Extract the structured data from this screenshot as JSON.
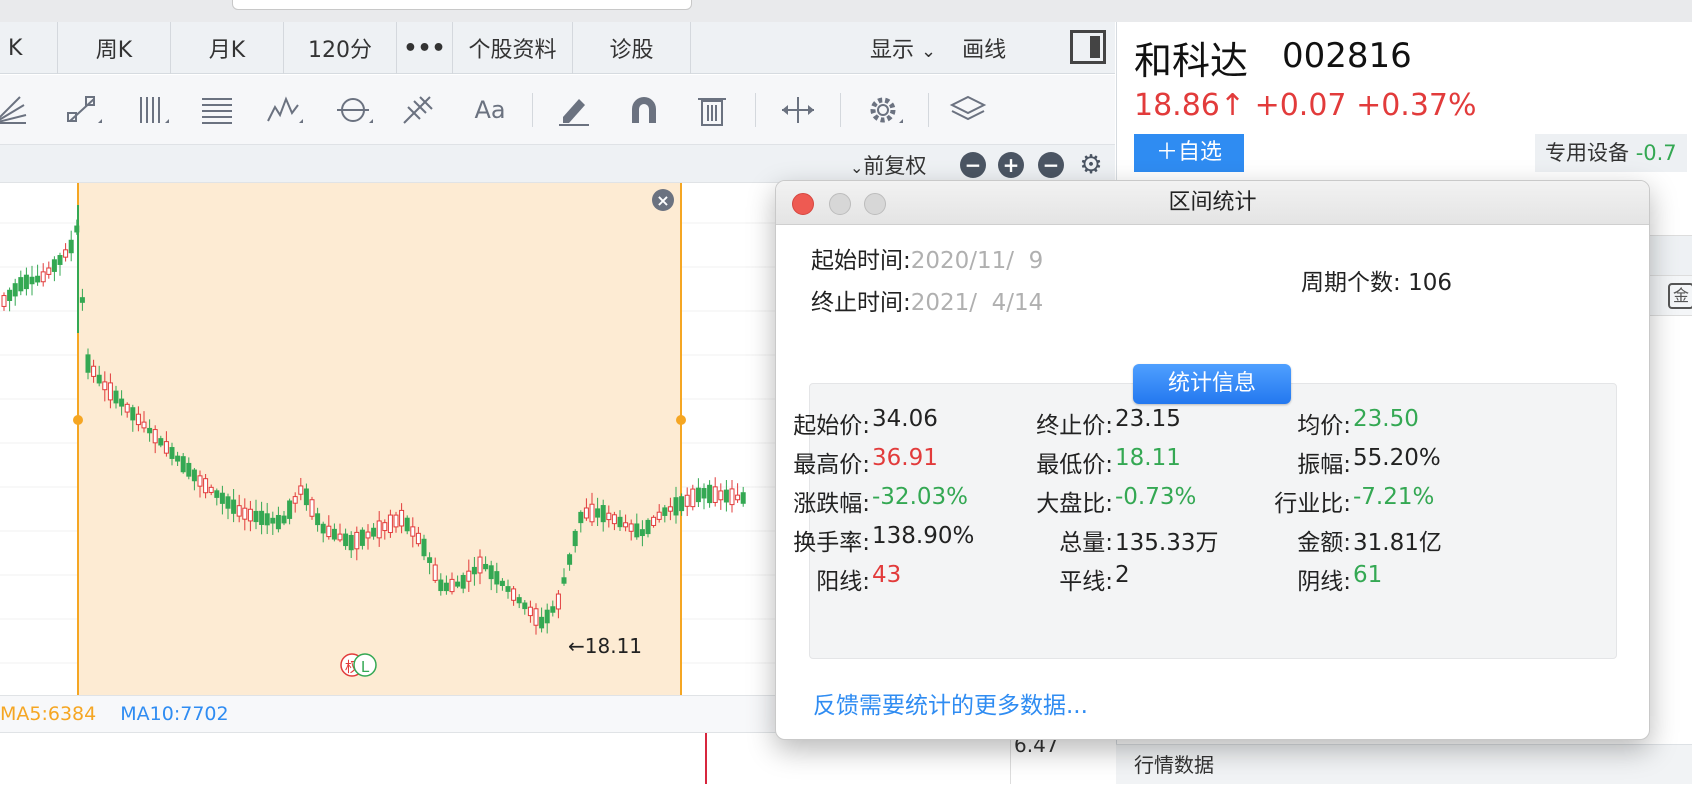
{
  "tabs": [
    "K",
    "周K",
    "月K",
    "120分",
    "•••",
    "个股资料",
    "诊股"
  ],
  "tabs_right": {
    "display": "显示",
    "draw": "画线"
  },
  "toolbar_icons": [
    "fan-icon",
    "segment-icon",
    "parallel-lines-icon",
    "gann-icon",
    "wave-icon",
    "cycle-icon",
    "fib-icon",
    "text-icon",
    "pen-icon",
    "magnet-icon",
    "trash-icon",
    "range-icon",
    "settings-icon",
    "layers-icon"
  ],
  "toolbar_text_icon": "Aa",
  "subbar": {
    "fuquan": "前复权"
  },
  "chart": {
    "low_label": "←18.11",
    "marker_quan": "权",
    "marker_l": "L",
    "colors": {
      "up": "#e23b3b",
      "down": "#34a853",
      "selection": "#fdebd3",
      "selection_edge": "#f5a623"
    }
  },
  "ma": {
    "ma5": "MA5:6384",
    "ma10": "MA10:7702"
  },
  "bottom": {
    "value": "6.47"
  },
  "stock": {
    "name": "和科达",
    "code": "002816",
    "price": "18.86↑",
    "change": "+0.07",
    "change_pct": "+0.37%",
    "add_fav": "＋自选",
    "industry": "专用设备",
    "industry_change": "-0.7"
  },
  "right_panel": {
    "hangqing": "行情数据",
    "gold_icon": "金"
  },
  "dialog": {
    "title": "区间统计",
    "start_label": "起始时间:",
    "start_value": "2020/11/  9",
    "end_label": "终止时间:",
    "end_value": "2021/  4/14",
    "period_label": "周期个数:",
    "period_value": "106",
    "stats_button": "统计信息",
    "stats": [
      [
        {
          "label": "起始价:",
          "value": "34.06",
          "color": "normal"
        },
        {
          "label": "终止价:",
          "value": "23.15",
          "color": "normal"
        },
        {
          "label": "均价:",
          "value": "23.50",
          "color": "green"
        }
      ],
      [
        {
          "label": "最高价:",
          "value": "36.91",
          "color": "red"
        },
        {
          "label": "最低价:",
          "value": "18.11",
          "color": "green"
        },
        {
          "label": "振幅:",
          "value": "55.20%",
          "color": "normal"
        }
      ],
      [
        {
          "label": "涨跌幅:",
          "value": "-32.03%",
          "color": "green"
        },
        {
          "label": "大盘比:",
          "value": "-0.73%",
          "color": "green"
        },
        {
          "label": "行业比:",
          "value": "-7.21%",
          "color": "green"
        }
      ],
      [
        {
          "label": "换手率:",
          "value": "138.90%",
          "color": "normal"
        },
        {
          "label": "总量:",
          "value": "135.33万",
          "color": "normal"
        },
        {
          "label": "金额:",
          "value": "31.81亿",
          "color": "normal"
        }
      ],
      [
        {
          "label": "阳线:",
          "value": "43",
          "color": "red"
        },
        {
          "label": "平线:",
          "value": "2",
          "color": "normal"
        },
        {
          "label": "阴线:",
          "value": "61",
          "color": "green"
        }
      ]
    ],
    "feedback": "反馈需要统计的更多数据..."
  }
}
